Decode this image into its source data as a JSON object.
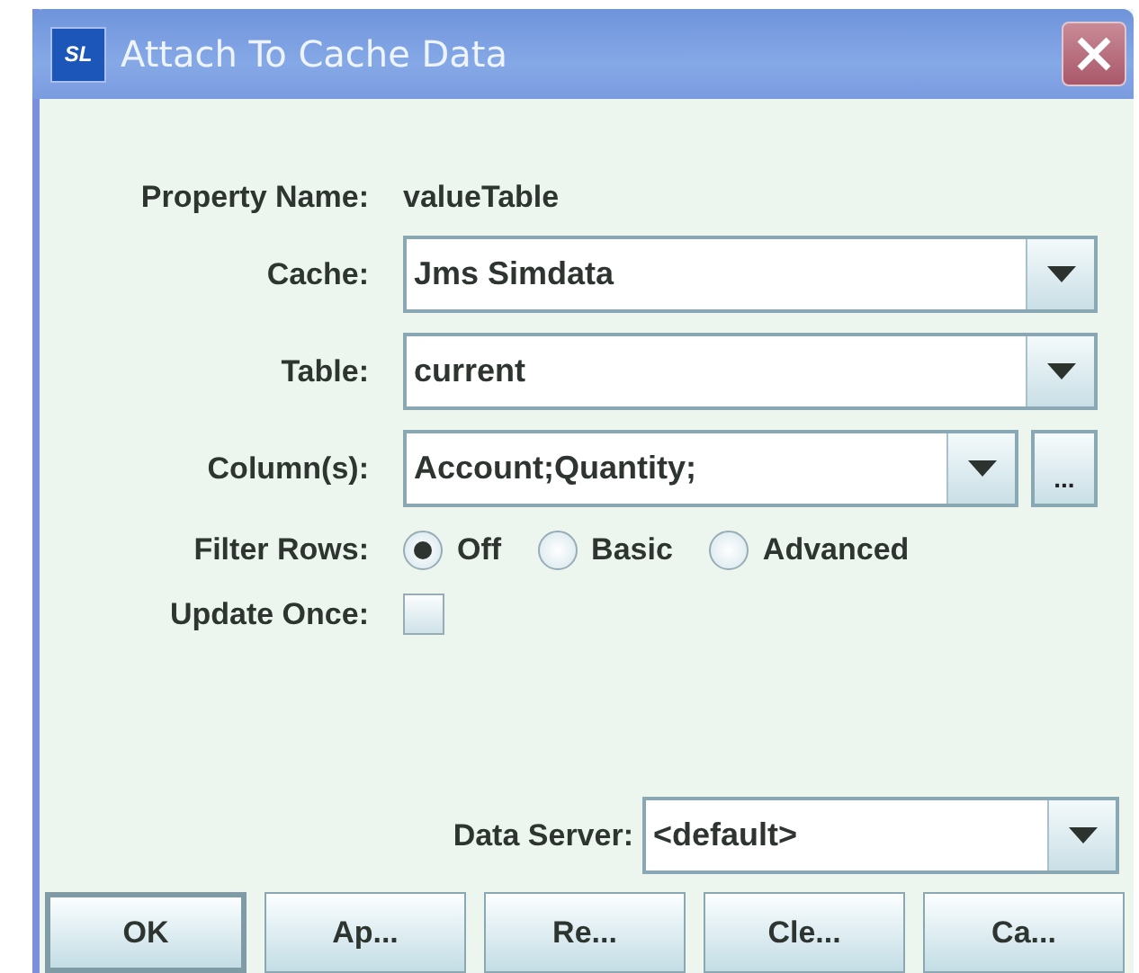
{
  "window": {
    "title": "Attach To Cache Data",
    "logo": "SL"
  },
  "fields": [
    {
      "kind": "text",
      "label": "Property Name:",
      "value": "valueTable"
    },
    {
      "kind": "combo",
      "label": "Cache:",
      "value": "Jms Simdata"
    },
    {
      "kind": "combo",
      "label": "Table:",
      "value": "current"
    },
    {
      "kind": "combo-more",
      "label": "Column(s):",
      "value": "Account;Quantity;",
      "button": "..."
    },
    {
      "kind": "radio",
      "label": "Filter Rows:",
      "options": [
        {
          "label": "Off",
          "selected": true
        },
        {
          "label": "Basic",
          "selected": false
        },
        {
          "label": "Advanced",
          "selected": false
        }
      ]
    },
    {
      "kind": "checkbox",
      "label": "Update Once:",
      "checked": false
    }
  ],
  "data_server": {
    "label": "Data Server:",
    "value": "<default>"
  },
  "buttons": [
    {
      "label": "OK",
      "default": true
    },
    {
      "label": "Ap...",
      "default": false
    },
    {
      "label": "Re...",
      "default": false
    },
    {
      "label": "Cle...",
      "default": false
    },
    {
      "label": "Ca...",
      "default": false
    }
  ]
}
